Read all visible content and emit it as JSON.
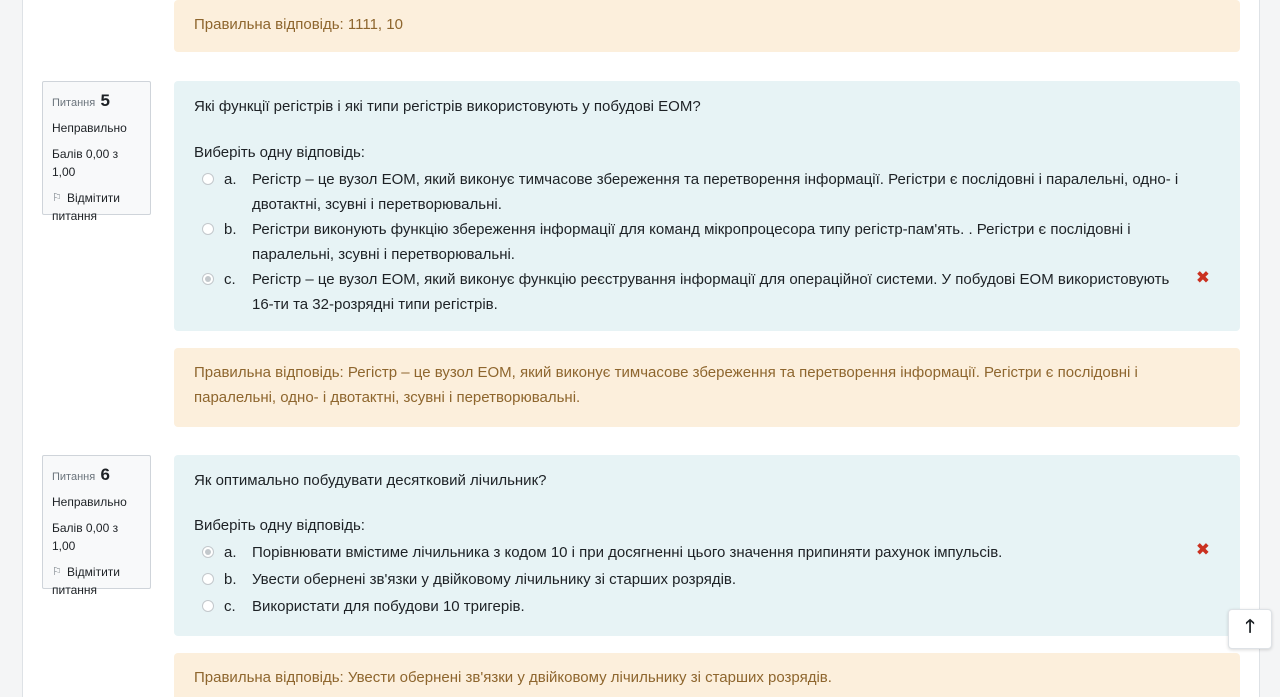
{
  "top_feedback": "Правильна відповідь: 1111, 10",
  "questions": [
    {
      "label": "Питання",
      "number": "5",
      "state": "Неправильно",
      "grade": "Балів 0,00 з 1,00",
      "flag_line1": "Відмітити",
      "flag_line2": "питання",
      "text": "Які функції регістрів і які типи регістрів використовують у побудові ЕОМ?",
      "prompt": "Виберіть одну відповідь:",
      "options": [
        {
          "letter": "a.",
          "line1": "Регістр – це вузол ЕОМ, який виконує тимчасове збереження та перетворення інформації. Регістри є послідовні і паралельні, одно- і",
          "line2": "двотактні, зсувні і перетворювальні.",
          "checked": false
        },
        {
          "letter": "b.",
          "line1": "Регістри виконують функцію збереження інформації для команд мікропроцесора типу регістр-пам'ять. . Регістри є послідовні і",
          "line2": "паралельні, зсувні і перетворювальні.",
          "checked": false
        },
        {
          "letter": "c.",
          "line1": "Регістр – це вузол ЕОМ, який виконує функцію реєстрування інформації для операційної системи. У побудові ЕОМ використовують",
          "line2": "16-ти та 32-розрядні типи регістрів.",
          "checked": true
        }
      ],
      "feedback_line1": "Правильна відповідь: Регістр – це вузол ЕОМ, який виконує тимчасове збереження та перетворення інформації. Регістри є послідовні і",
      "feedback_line2": "паралельні, одно- і двотактні, зсувні і перетворювальні."
    },
    {
      "label": "Питання",
      "number": "6",
      "state": "Неправильно",
      "grade": "Балів 0,00 з 1,00",
      "flag_line1": "Відмітити",
      "flag_line2": "питання",
      "text": "Як оптимально побудувати десятковий лічильник?",
      "prompt": "Виберіть одну відповідь:",
      "options": [
        {
          "letter": "a.",
          "line1": "Порівнювати вмістиме лічильника з кодом 10 і при досягненні цього значення припиняти рахунок імпульсів.",
          "checked": true
        },
        {
          "letter": "b.",
          "line1": "Увести обернені зв'язки у двійковому лічильнику зі старших розрядів.",
          "checked": false
        },
        {
          "letter": "c.",
          "line1": "Використати для побудови 10 тригерів.",
          "checked": false
        }
      ],
      "feedback_line1": "Правильна відповідь: Увести обернені зв'язки у двійковому лічильнику зі старших розрядів."
    }
  ],
  "icons": {
    "incorrect": "✖",
    "back_to_top": "🡑",
    "flag": "⚐"
  },
  "colors": {
    "feedback_bg": "#fcefdc",
    "feedback_text": "#8e662e",
    "formulation_bg": "#e7f3f5",
    "incorrect": "#ca3120"
  }
}
